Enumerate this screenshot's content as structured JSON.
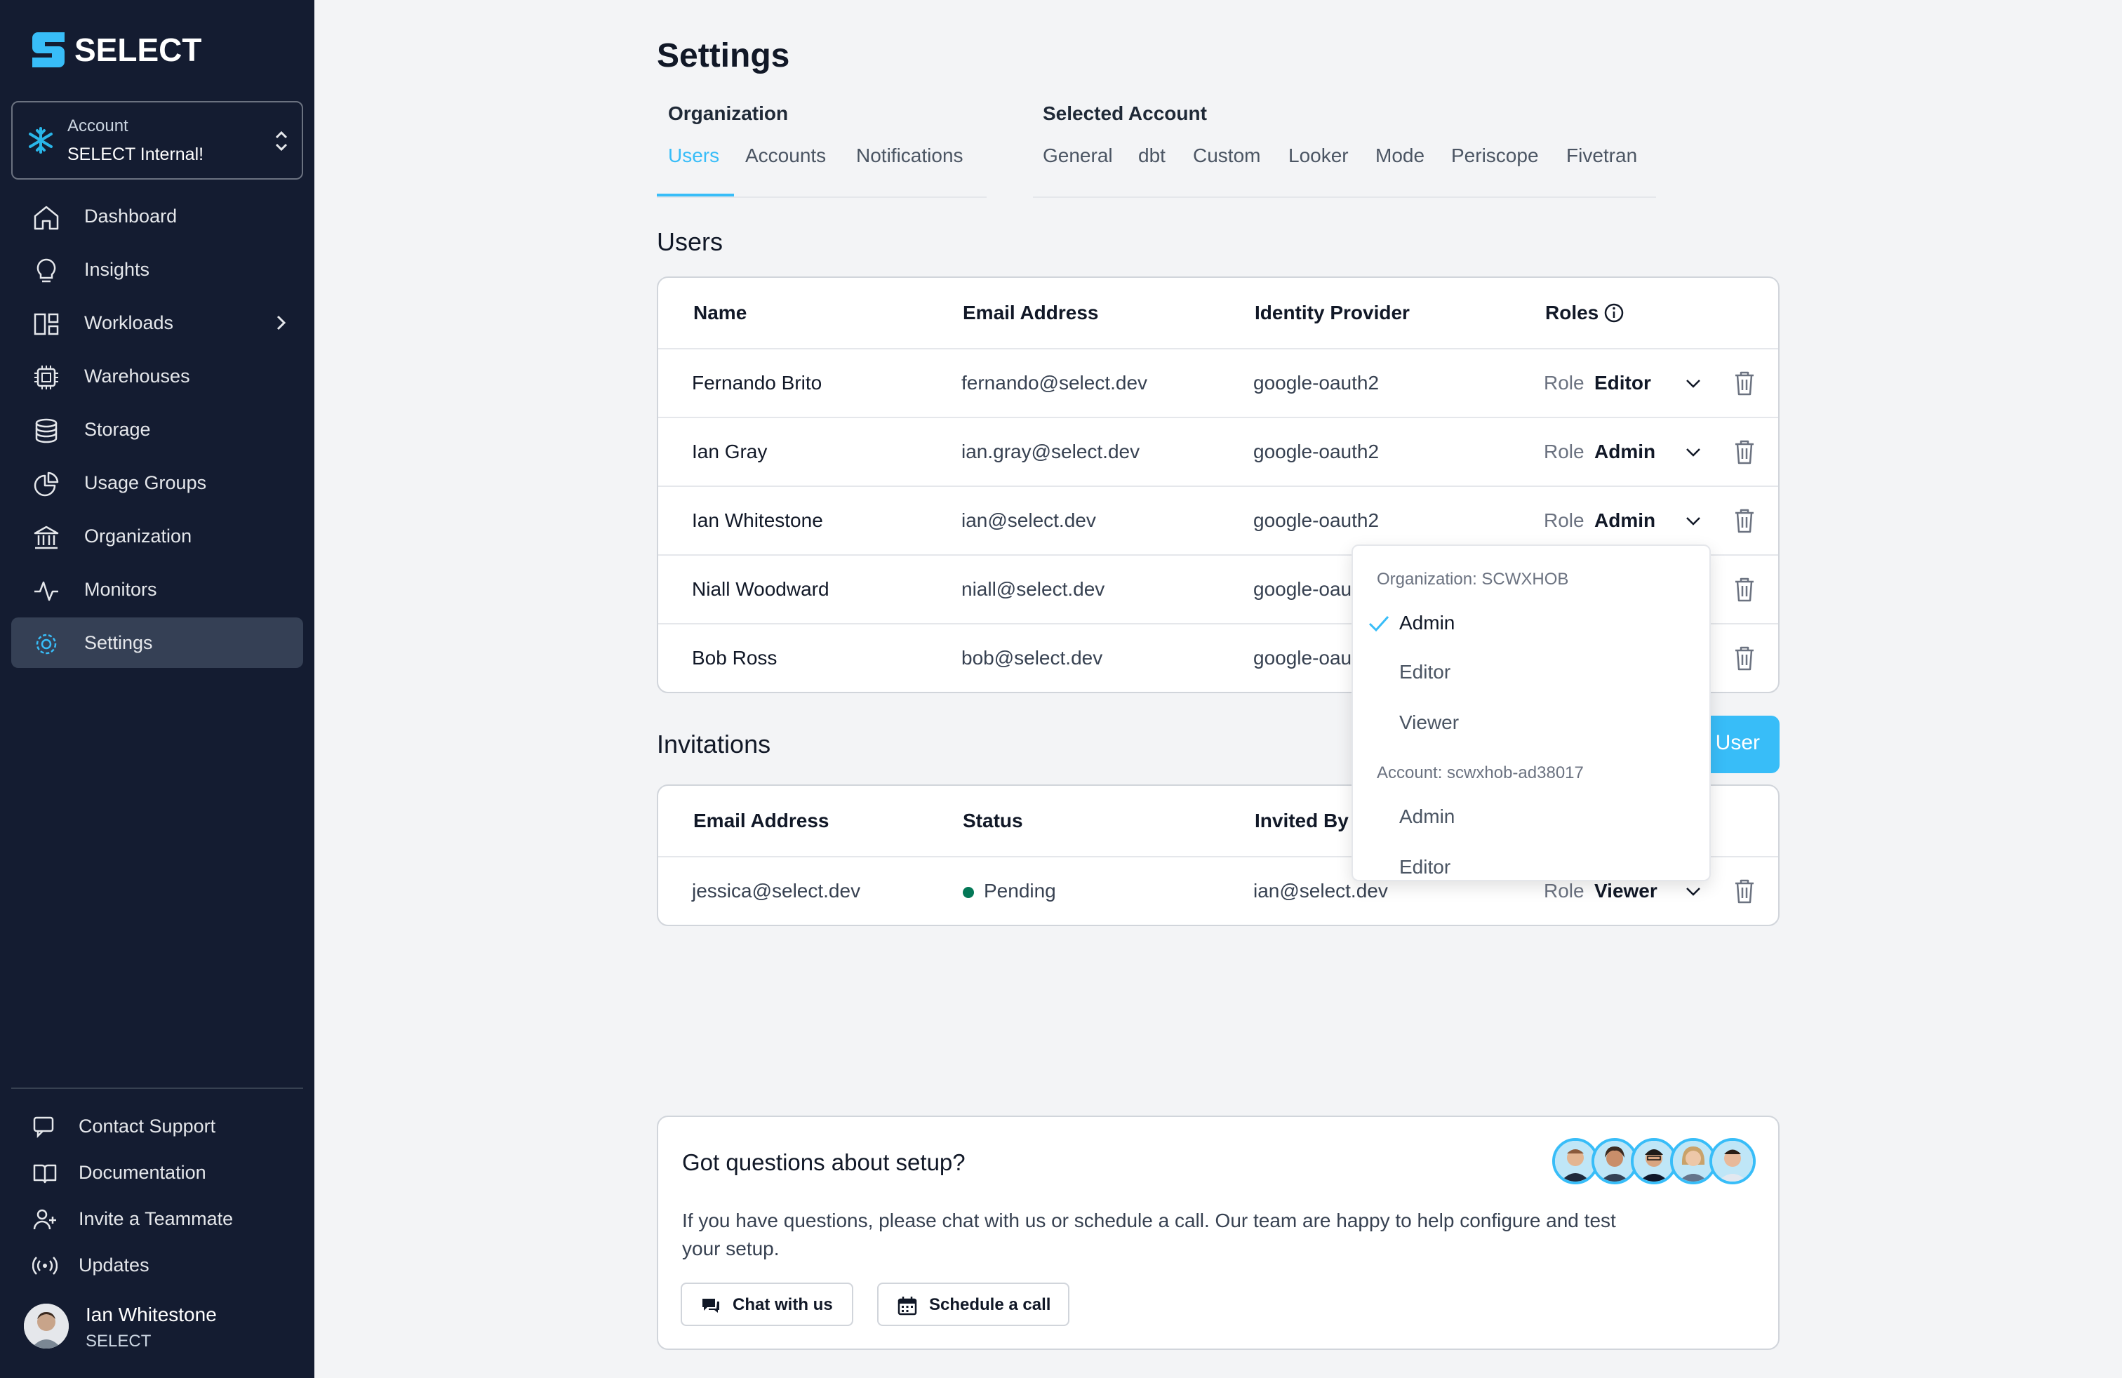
{
  "app": {
    "name": "SELECT"
  },
  "account": {
    "label": "Account",
    "value": "SELECT Internal!"
  },
  "nav": [
    {
      "label": "Dashboard",
      "icon": "home-icon"
    },
    {
      "label": "Insights",
      "icon": "lightbulb-icon"
    },
    {
      "label": "Workloads",
      "icon": "layout-icon"
    },
    {
      "label": "Warehouses",
      "icon": "chip-icon"
    },
    {
      "label": "Storage",
      "icon": "database-icon"
    },
    {
      "label": "Usage Groups",
      "icon": "pie-icon"
    },
    {
      "label": "Organization",
      "icon": "bank-icon"
    },
    {
      "label": "Monitors",
      "icon": "pulse-icon"
    },
    {
      "label": "Settings",
      "icon": "gear-icon"
    }
  ],
  "footer_nav": [
    {
      "label": "Contact Support",
      "icon": "chat-icon"
    },
    {
      "label": "Documentation",
      "icon": "book-icon"
    },
    {
      "label": "Invite a Teammate",
      "icon": "user-plus-icon"
    },
    {
      "label": "Updates",
      "icon": "broadcast-icon"
    }
  ],
  "current_user": {
    "name": "Ian Whitestone",
    "org": "SELECT"
  },
  "page": {
    "title": "Settings",
    "org_group": "Organization",
    "org_tabs": [
      "Users",
      "Accounts",
      "Notifications"
    ],
    "acct_group": "Selected Account",
    "acct_tabs": [
      "General",
      "dbt",
      "Custom",
      "Looker",
      "Mode",
      "Periscope",
      "Fivetran"
    ]
  },
  "users": {
    "title": "Users",
    "headers": [
      "Name",
      "Email Address",
      "Identity Provider",
      "Roles"
    ],
    "role_label": "Role",
    "rows": [
      {
        "name": "Fernando Brito",
        "email": "fernando@select.dev",
        "idp": "google-oauth2",
        "role": "Editor"
      },
      {
        "name": "Ian Gray",
        "email": "ian.gray@select.dev",
        "idp": "google-oauth2",
        "role": "Admin"
      },
      {
        "name": "Ian Whitestone",
        "email": "ian@select.dev",
        "idp": "google-oauth2",
        "role": "Admin"
      },
      {
        "name": "Niall Woodward",
        "email": "niall@select.dev",
        "idp": "google-oau"
      },
      {
        "name": "Bob Ross",
        "email": "bob@select.dev",
        "idp": "google-oau"
      }
    ]
  },
  "dropdown": {
    "org_heading": "Organization: SCWXHOB",
    "org_options": [
      "Admin",
      "Editor",
      "Viewer"
    ],
    "selected": "Admin",
    "acct_heading": "Account: scwxhob-ad38017",
    "acct_options": [
      "Admin",
      "Editor"
    ]
  },
  "invitations": {
    "title": "Invitations",
    "add_button": "User",
    "headers": [
      "Email Address",
      "Status",
      "Invited By"
    ],
    "rows": [
      {
        "email": "jessica@select.dev",
        "status": "Pending",
        "invited_by": "ian@select.dev",
        "role": "Viewer"
      }
    ]
  },
  "help": {
    "title": "Got questions about setup?",
    "text": "If you have questions, please chat with us or schedule a call. Our team are happy to help configure and test your setup.",
    "chat_button": "Chat with us",
    "call_button": "Schedule a call"
  },
  "colors": {
    "sidebar": "#141c31",
    "accent": "#38bdf8",
    "status_pending": "#047857"
  }
}
